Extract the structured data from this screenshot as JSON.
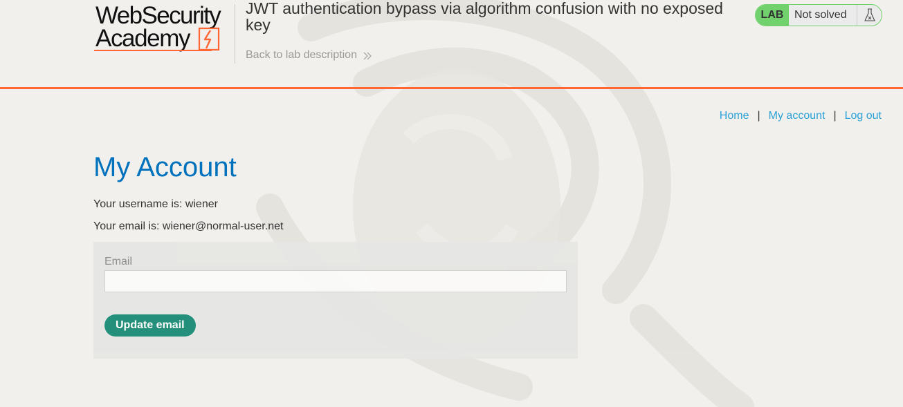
{
  "logo": {
    "line1": "WebSecurity",
    "line2": "Academy"
  },
  "lab": {
    "title": "JWT authentication bypass via algorithm confusion with no exposed key",
    "back_link": "Back to lab description",
    "badge": "LAB",
    "status": "Not solved",
    "status_icon": "flask-icon"
  },
  "nav": {
    "home": "Home",
    "separator": "|",
    "my_account": "My account",
    "log_out": "Log out"
  },
  "main": {
    "title": "My Account",
    "username_line": "Your username is: wiener",
    "email_line": "Your email is: wiener@normal-user.net",
    "form": {
      "email_label": "Email",
      "email_value": "",
      "email_placeholder": "",
      "submit_label": "Update email"
    }
  },
  "colors": {
    "accent_orange": "#ff6633",
    "link_blue": "#29a1d8",
    "title_blue": "#0071bc",
    "lab_green": "#70d16d",
    "button_green": "#1a8b77"
  }
}
